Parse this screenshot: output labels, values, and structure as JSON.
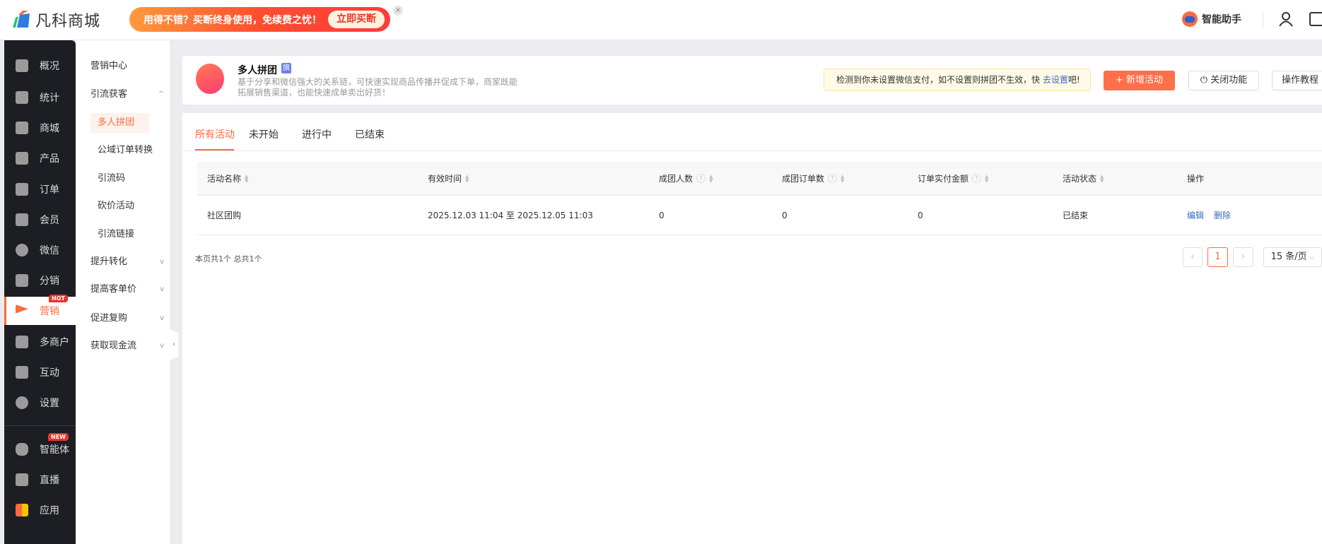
{
  "header": {
    "logo_text": "凡科商城",
    "banner_text": "用得不错？买断终身使用，免续费之忧！",
    "banner_button": "立即买断",
    "banner_close": "×",
    "assistant": "智能助手"
  },
  "nav": {
    "items": [
      {
        "label": "概况"
      },
      {
        "label": "统计"
      },
      {
        "label": "商城"
      },
      {
        "label": "产品"
      },
      {
        "label": "订单"
      },
      {
        "label": "会员"
      },
      {
        "label": "微信"
      },
      {
        "label": "分销"
      },
      {
        "label": "营销",
        "badge": "HOT"
      },
      {
        "label": "多商户"
      },
      {
        "label": "互动"
      },
      {
        "label": "设置"
      },
      {
        "label": "智能体",
        "badge": "NEW"
      },
      {
        "label": "直播"
      },
      {
        "label": "应用"
      }
    ]
  },
  "submenu": {
    "items": [
      {
        "label": "营销中心"
      },
      {
        "label": "引流获客",
        "chevron": "^"
      },
      {
        "label": "多人拼团"
      },
      {
        "label": "公域订单转换"
      },
      {
        "label": "引流码"
      },
      {
        "label": "砍价活动"
      },
      {
        "label": "引流链接"
      },
      {
        "label": "提升转化",
        "chevron": "v"
      },
      {
        "label": "提高客单价",
        "chevron": "v"
      },
      {
        "label": "促进复购",
        "chevron": "v"
      },
      {
        "label": "获取现金流",
        "chevron": "v"
      }
    ]
  },
  "feature": {
    "title": "多人拼团",
    "badge": "旗",
    "description": "基于分享和微信强大的关系链，可快速实现商品传播并促成下单，商家既能拓展销售渠道，也能快速成单卖出好货！",
    "alert_text": "检测到你未设置微信支付，如不设置则拼团不生效，快 ",
    "alert_link": "去设置",
    "alert_suffix": "吧!",
    "new_button": "+ 新增活动",
    "close_button": "关闭功能",
    "guide_button": "操作教程"
  },
  "tabs": [
    "所有活动",
    "未开始",
    "进行中",
    "已结束"
  ],
  "table": {
    "headers": [
      "活动名称",
      "有效时间",
      "成团人数",
      "成团订单数",
      "订单实付金额",
      "活动状态",
      "操作"
    ],
    "rows": [
      {
        "name": "社区团购",
        "time": "2025.12.03 11:04 至 2025.12.05 11:03",
        "members": "0",
        "orders": "0",
        "amount": "0",
        "status": "已结束",
        "actions": [
          "编辑",
          "删除"
        ]
      }
    ]
  },
  "footer": {
    "count": "本页共1个 总共1个",
    "page": "1",
    "page_size": "15 条/页",
    "prev": "‹",
    "next": "›"
  },
  "colors": {
    "accent": "#ff6a3d",
    "sidebar": "#1d1e23",
    "link": "#3a6ab8"
  }
}
